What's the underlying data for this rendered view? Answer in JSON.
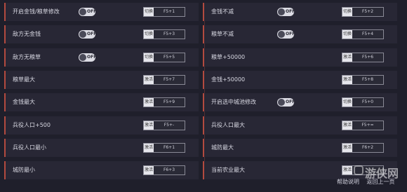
{
  "colors": {
    "background": "#1f1f2b",
    "row_background": "#282735",
    "accent": "#b34a3f",
    "toggle_bg": "#dcdce4"
  },
  "left_items": [
    {
      "label": "开启金钱/粮草修改",
      "toggle": "OFF",
      "action": "切换",
      "hotkey": "F5+1"
    },
    {
      "label": "敌方无金钱",
      "toggle": "OFF",
      "action": "切换",
      "hotkey": "F5+3"
    },
    {
      "label": "敌方无粮草",
      "toggle": "OFF",
      "action": "切换",
      "hotkey": "F5+5"
    },
    {
      "label": "粮草最大",
      "toggle": null,
      "action": "激活",
      "hotkey": "F5+7"
    },
    {
      "label": "金钱最大",
      "toggle": null,
      "action": "激活",
      "hotkey": "F5+9"
    },
    {
      "label": "兵役人口+500",
      "toggle": null,
      "action": "激活",
      "hotkey": "F5+-"
    },
    {
      "label": "兵役人口最小",
      "toggle": null,
      "action": "激活",
      "hotkey": "F6+1"
    },
    {
      "label": "城防最小",
      "toggle": null,
      "action": "激活",
      "hotkey": "F6+3"
    }
  ],
  "right_items": [
    {
      "label": "金钱不减",
      "toggle": "OFF",
      "action": "切换",
      "hotkey": "F5+2"
    },
    {
      "label": "粮草不减",
      "toggle": "OFF",
      "action": "切换",
      "hotkey": "F5+4"
    },
    {
      "label": "粮草+50000",
      "toggle": null,
      "action": "激活",
      "hotkey": "F5+6"
    },
    {
      "label": "金钱+50000",
      "toggle": null,
      "action": "激活",
      "hotkey": "F5+8"
    },
    {
      "label": "开启选中城池修改",
      "toggle": "OFF",
      "action": "切换",
      "hotkey": "F5+0"
    },
    {
      "label": "兵役人口最大",
      "toggle": null,
      "action": "激活",
      "hotkey": "F5+="
    },
    {
      "label": "城防最大",
      "toggle": null,
      "action": "激活",
      "hotkey": "F6+2"
    },
    {
      "label": "当前农业最大",
      "toggle": null,
      "action": "激活",
      "hotkey": ""
    }
  ],
  "footer": {
    "help": "帮助说明",
    "prev_page": "返回上一页"
  },
  "watermark": {
    "text": "游侠网",
    "icon": "gamersky-logo-icon"
  }
}
